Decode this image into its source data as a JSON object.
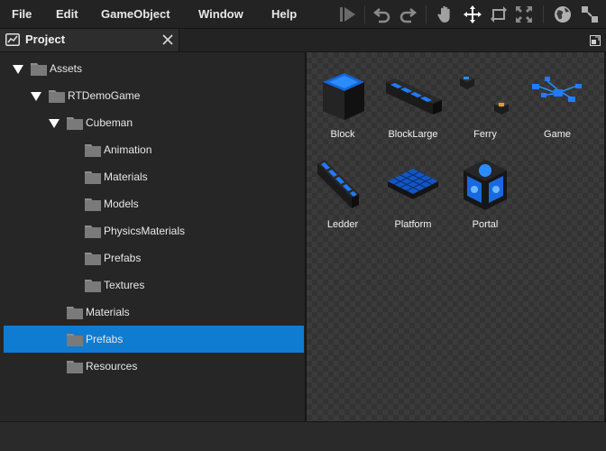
{
  "menubar": {
    "items": [
      "File",
      "Edit",
      "GameObject",
      "Window",
      "Help"
    ],
    "tools": [
      "play-icon",
      "undo-icon",
      "redo-icon",
      "hand-icon",
      "move-icon",
      "rotate-icon",
      "scale-icon",
      "globe-icon",
      "pivot-icon"
    ]
  },
  "panel": {
    "title": "Project",
    "close_icon": "close-icon",
    "maximize_icon": "maximize-icon"
  },
  "tree": {
    "items": [
      {
        "label": "Assets",
        "expanded": true,
        "selected": false
      },
      {
        "label": "RTDemoGame",
        "expanded": true,
        "selected": false
      },
      {
        "label": "Cubeman",
        "expanded": true,
        "selected": false
      },
      {
        "label": "Animation",
        "expanded": false,
        "selected": false
      },
      {
        "label": "Materials",
        "expanded": false,
        "selected": false
      },
      {
        "label": "Models",
        "expanded": false,
        "selected": false
      },
      {
        "label": "PhysicsMaterials",
        "expanded": false,
        "selected": false
      },
      {
        "label": "Prefabs",
        "expanded": false,
        "selected": false
      },
      {
        "label": "Textures",
        "expanded": false,
        "selected": false
      },
      {
        "label": "Materials",
        "expanded": false,
        "selected": false
      },
      {
        "label": "Prefabs",
        "expanded": false,
        "selected": true
      },
      {
        "label": "Resources",
        "expanded": false,
        "selected": false
      }
    ]
  },
  "assets": {
    "items": [
      {
        "label": "Block",
        "icon": "block-prefab-icon"
      },
      {
        "label": "BlockLarge",
        "icon": "block-large-prefab-icon"
      },
      {
        "label": "Ferry",
        "icon": "ferry-prefab-icon"
      },
      {
        "label": "Game",
        "icon": "game-prefab-icon"
      },
      {
        "label": "Ledder",
        "icon": "ledder-prefab-icon"
      },
      {
        "label": "Platform",
        "icon": "platform-prefab-icon"
      },
      {
        "label": "Portal",
        "icon": "portal-prefab-icon"
      }
    ]
  },
  "colors": {
    "selection": "#0f7bd1",
    "accent_blue": "#1e7fff",
    "background": "#262626"
  }
}
